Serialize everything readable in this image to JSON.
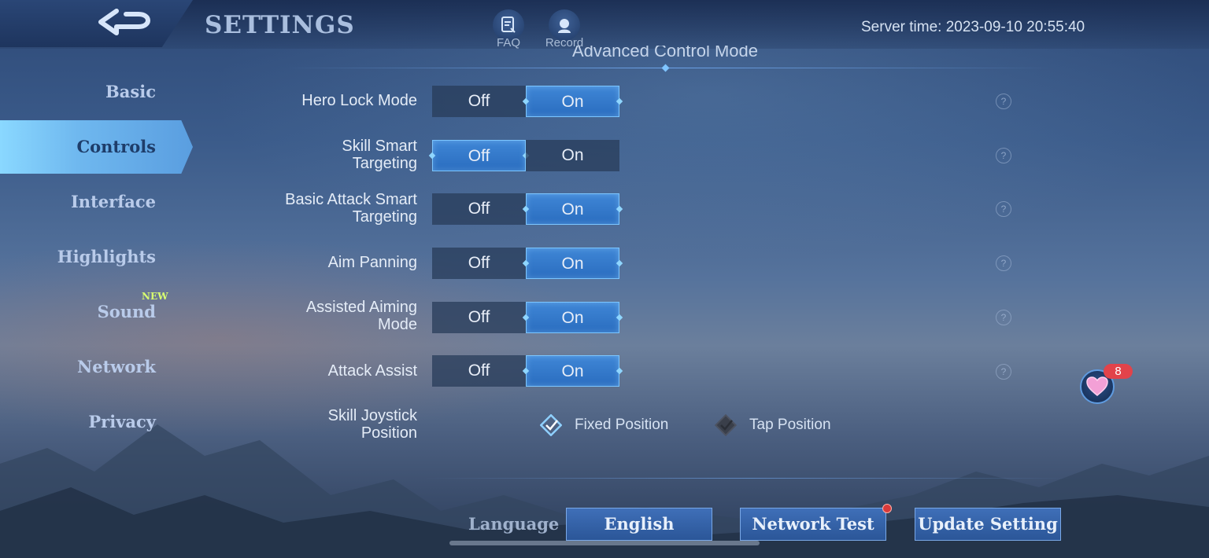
{
  "header": {
    "title": "SETTINGS",
    "faq_label": "FAQ",
    "record_label": "Record",
    "server_time": "Server time: 2023-09-10 20:55:40"
  },
  "section_title": "Advanced Control Mode",
  "sidebar": {
    "items": [
      {
        "label": "Basic"
      },
      {
        "label": "Controls",
        "active": true
      },
      {
        "label": "Interface"
      },
      {
        "label": "Highlights"
      },
      {
        "label": "Sound",
        "badge": "NEW"
      },
      {
        "label": "Network"
      },
      {
        "label": "Privacy"
      }
    ]
  },
  "controls": {
    "off_label": "Off",
    "on_label": "On",
    "rows": [
      {
        "label": "Hero Lock Mode",
        "selected": "On"
      },
      {
        "label": "Skill Smart Targeting",
        "selected": "Off"
      },
      {
        "label": "Basic Attack Smart Targeting",
        "selected": "On"
      },
      {
        "label": "Aim Panning",
        "selected": "On"
      },
      {
        "label": "Assisted Aiming Mode",
        "selected": "On"
      },
      {
        "label": "Attack Assist",
        "selected": "On"
      }
    ],
    "joystick": {
      "label": "Skill Joystick Position",
      "options": [
        "Fixed Position",
        "Tap Position"
      ],
      "selected": "Fixed Position"
    }
  },
  "footer": {
    "language_label": "Language",
    "language_value": "English",
    "network_test": "Network Test",
    "update_setting": "Update Setting"
  },
  "floating": {
    "heart_count": "8"
  },
  "colors": {
    "selected_toggle": "#2f76c8",
    "accent_glow": "#8ad8ff",
    "badge_red": "#e2434a",
    "new_badge": "#d8ff70"
  },
  "help_icon": "?"
}
